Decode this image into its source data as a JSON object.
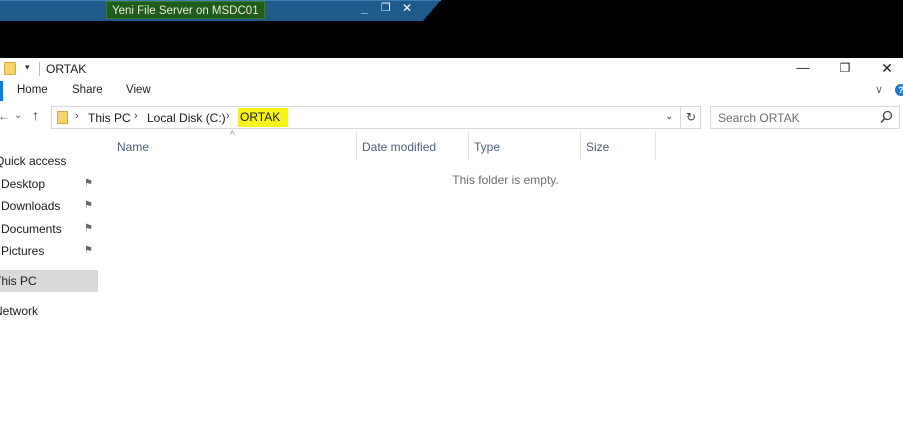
{
  "remote_session": {
    "title": "Yeni File Server on MSDC01",
    "buttons": {
      "minimize": "_",
      "restore": "❐",
      "close": "✕"
    },
    "tab_color": "#1f5a8a"
  },
  "window": {
    "title": "ORTAK",
    "quick_access_glyph": "▾",
    "buttons": {
      "minimize": "—",
      "maximize": "❐",
      "close": "✕"
    }
  },
  "ribbon": {
    "tabs": [
      "Home",
      "Share",
      "View"
    ],
    "expand_glyph": "∨",
    "help_label": "?"
  },
  "navigation": {
    "back": "←",
    "forward": "→",
    "recent": "⌄",
    "up": "↑"
  },
  "address_bar": {
    "breadcrumb": [
      "This PC",
      "Local Disk (C:)",
      "ORTAK"
    ],
    "separator": "›",
    "dropdown_glyph": "⌄",
    "refresh_glyph": "↻",
    "highlight_color": "#f7f21c"
  },
  "search": {
    "placeholder": "Search ORTAK",
    "icon": "search-icon"
  },
  "nav_pane": {
    "items": [
      {
        "label": "Quick access",
        "pinned": false
      },
      {
        "label": "Desktop",
        "pinned": true
      },
      {
        "label": "Downloads",
        "pinned": true
      },
      {
        "label": "Documents",
        "pinned": true
      },
      {
        "label": "Pictures",
        "pinned": true
      },
      {
        "label": "This PC",
        "pinned": false,
        "selected": true
      },
      {
        "label": "Network",
        "pinned": false
      }
    ],
    "pin_glyph": "📌"
  },
  "file_list": {
    "columns": [
      "Name",
      "Date modified",
      "Type",
      "Size"
    ],
    "sort_glyph": "^",
    "empty_message": "This folder is empty."
  }
}
